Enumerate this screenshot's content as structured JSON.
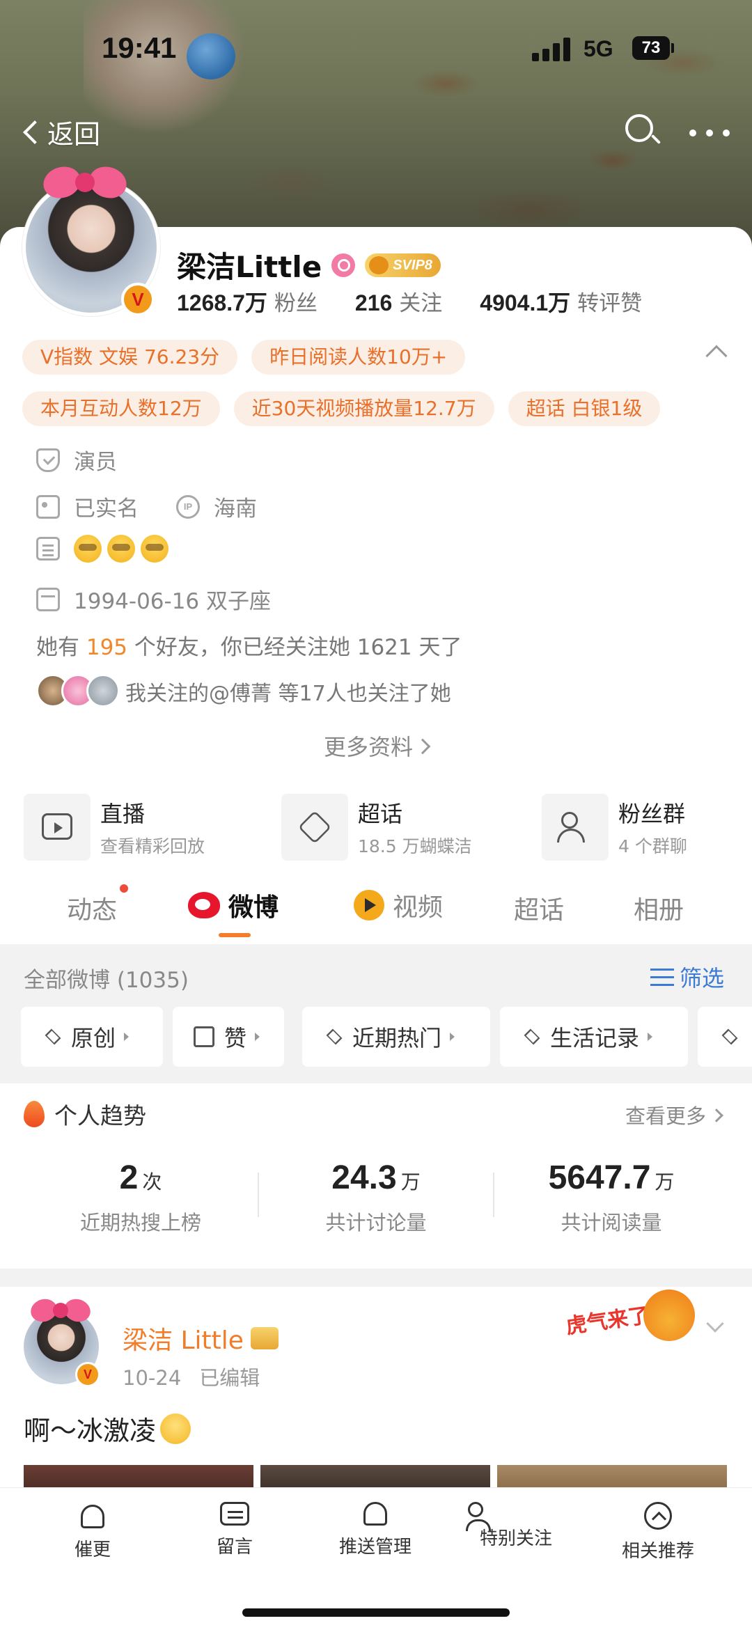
{
  "status_bar": {
    "time": "19:41",
    "network": "5G",
    "battery": "73"
  },
  "nav": {
    "back_label": "返回"
  },
  "profile": {
    "name": "梁洁Little",
    "vip_badge": "SVIP8",
    "stats": [
      {
        "value": "1268.7万",
        "label": "粉丝"
      },
      {
        "value": "216",
        "label": "关注"
      },
      {
        "value": "4904.1万",
        "label": "转评赞"
      }
    ],
    "chips_row1": [
      "V指数 文娱 76.23分",
      "昨日阅读人数10万+"
    ],
    "chips_row2": [
      "本月互动人数12万",
      "近30天视频播放量12.7万",
      "超话 白银1级"
    ],
    "occupation": "演员",
    "verified": "已实名",
    "ip_icon": "IP",
    "location": "海南",
    "birthday": "1994-06-16 双子座",
    "friends_prefix": "她有 ",
    "friends_count": "195",
    "friends_suffix": " 个好友，你已经关注她 1621 天了",
    "common_follow": "我关注的@傅菁 等17人也关注了她",
    "more_info": "更多资料"
  },
  "features": [
    {
      "title": "直播",
      "sub": "查看精彩回放",
      "icon": "tv-icon"
    },
    {
      "title": "超话",
      "sub": "18.5 万蝴蝶洁",
      "icon": "diamond-icon"
    },
    {
      "title": "粉丝群",
      "sub": "4 个群聊",
      "icon": "group-icon"
    }
  ],
  "tabs": [
    "动态",
    "微博",
    "视频",
    "超话",
    "相册"
  ],
  "active_tab": "微博",
  "filter": {
    "all_label": "全部微博 (1035)",
    "filter_label": "筛选",
    "pills": [
      "原创",
      "赞",
      "近期热门",
      "生活记录"
    ]
  },
  "trend": {
    "title": "个人趋势",
    "see_more": "查看更多",
    "metrics": [
      {
        "value": "2",
        "unit": "次",
        "label": "近期热搜上榜"
      },
      {
        "value": "24.3",
        "unit": "万",
        "label": "共计讨论量"
      },
      {
        "value": "5647.7",
        "unit": "万",
        "label": "共计阅读量"
      }
    ]
  },
  "post": {
    "author": "梁洁 Little",
    "date": "10-24",
    "edited": "已编辑",
    "sticker_text": "虎气来了",
    "text": "啊～冰激凌"
  },
  "bottom_bar": [
    "催更",
    "留言",
    "推送管理",
    "特别关注",
    "相关推荐"
  ],
  "colors": {
    "accent_orange": "#f57c2b",
    "chip_text": "#e8702a",
    "link_blue": "#3b7bd4",
    "name_orange": "#f07d2a"
  }
}
